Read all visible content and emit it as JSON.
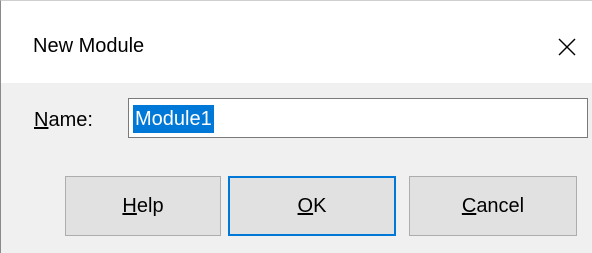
{
  "dialog": {
    "title": "New Module",
    "close_icon": "close-icon"
  },
  "name_field": {
    "label_mnemonic": "N",
    "label_rest": "ame:",
    "value": "Module1"
  },
  "buttons": {
    "help": {
      "mnemonic": "H",
      "rest": "elp"
    },
    "ok": {
      "mnemonic": "O",
      "rest": "K"
    },
    "cancel": {
      "mnemonic": "C",
      "rest": "ancel"
    }
  },
  "colors": {
    "accent": "#0078d7",
    "button_bg": "#e1e1e1",
    "dialog_bg": "#f0f0f0"
  }
}
